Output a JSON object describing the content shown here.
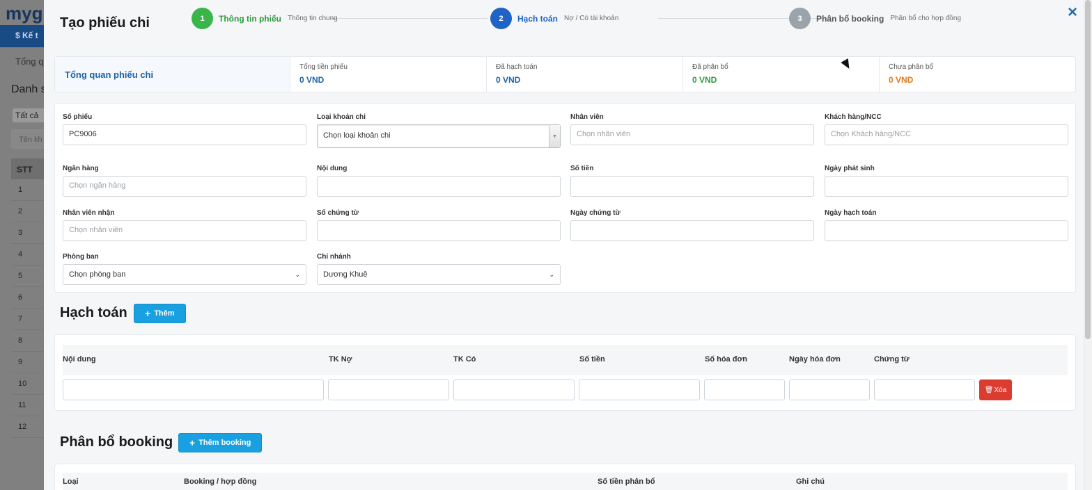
{
  "background": {
    "brand": "myg",
    "nav_item": "$ Kế t",
    "tab": "Tổng qu",
    "title": "Danh s",
    "filter": "Tất cả",
    "search_placeholder": "Tên kh",
    "table_header": "STT",
    "rows": [
      "1",
      "2",
      "3",
      "4",
      "5",
      "6",
      "7",
      "8",
      "9",
      "10",
      "11",
      "12"
    ]
  },
  "modal": {
    "title": "Tạo phiếu chi",
    "close_label": "×"
  },
  "stepper": [
    {
      "num": "1",
      "label": "Thông tin phiếu",
      "sub": "Thông tin chung",
      "color": "#3ab54a",
      "label_color": "#2f9a3a"
    },
    {
      "num": "2",
      "label": "Hạch toán",
      "sub": "Nợ / Có tài khoản",
      "color": "#1f63c6",
      "label_color": "#1f63c6"
    },
    {
      "num": "3",
      "label": "Phân bổ booking",
      "sub": "Phân bổ cho hợp đồng",
      "color": "#9ca3ab",
      "label_color": "#555"
    }
  ],
  "overview": {
    "title": "Tổng quan phiếu chi",
    "cells": [
      {
        "label": "Tổng tiền phiếu",
        "value": "0 VND",
        "color": "#1f63a6"
      },
      {
        "label": "Đã hạch toán",
        "value": "0 VND",
        "color": "#1f63a6"
      },
      {
        "label": "Đã phân bổ",
        "value": "0 VND",
        "color": "#2f9a3a"
      },
      {
        "label": "Chưa phân bổ",
        "value": "0 VND",
        "color": "#e07b1a"
      }
    ]
  },
  "form": {
    "so_phieu": {
      "label": "Số phiếu",
      "value": "PC9006"
    },
    "loai_khoan_chi": {
      "label": "Loại khoản chi",
      "value": "Chọn loại khoản chi"
    },
    "nhan_vien": {
      "label": "Nhân viên",
      "placeholder": "Chọn nhân viên"
    },
    "khach_hang": {
      "label": "Khách hàng/NCC",
      "placeholder": "Chọn Khách hàng/NCC"
    },
    "ngan_hang": {
      "label": "Ngân hàng",
      "placeholder": "Chọn ngân hàng"
    },
    "noi_dung": {
      "label": "Nội dung",
      "value": ""
    },
    "so_tien": {
      "label": "Số tiền",
      "value": ""
    },
    "ngay_phat_sinh": {
      "label": "Ngày phát sinh",
      "value": ""
    },
    "nhan_vien_nhan": {
      "label": "Nhân viên nhận",
      "placeholder": "Chọn nhân viên"
    },
    "so_chung_tu": {
      "label": "Số chứng từ",
      "value": ""
    },
    "ngay_chung_tu": {
      "label": "Ngày chứng từ",
      "value": ""
    },
    "ngay_hach_toan": {
      "label": "Ngày hạch toán",
      "value": ""
    },
    "phong_ban": {
      "label": "Phòng ban",
      "value": "Chọn phòng ban"
    },
    "chi_nhanh": {
      "label": "Chi nhánh",
      "value": "Dương Khuê"
    }
  },
  "hach_toan": {
    "title": "Hạch toán",
    "add_label": "Thêm",
    "columns": [
      "Nội dung",
      "TK Nợ",
      "TK Có",
      "Số tiền",
      "Số hóa đơn",
      "Ngày hóa đơn",
      "Chứng từ"
    ],
    "delete_label": "Xóa"
  },
  "phan_bo": {
    "title": "Phân bổ booking",
    "add_label": "Thêm booking",
    "columns": [
      "Loại",
      "Booking / hợp đồng",
      "Số tiền phân bổ",
      "Ghi chú"
    ]
  }
}
